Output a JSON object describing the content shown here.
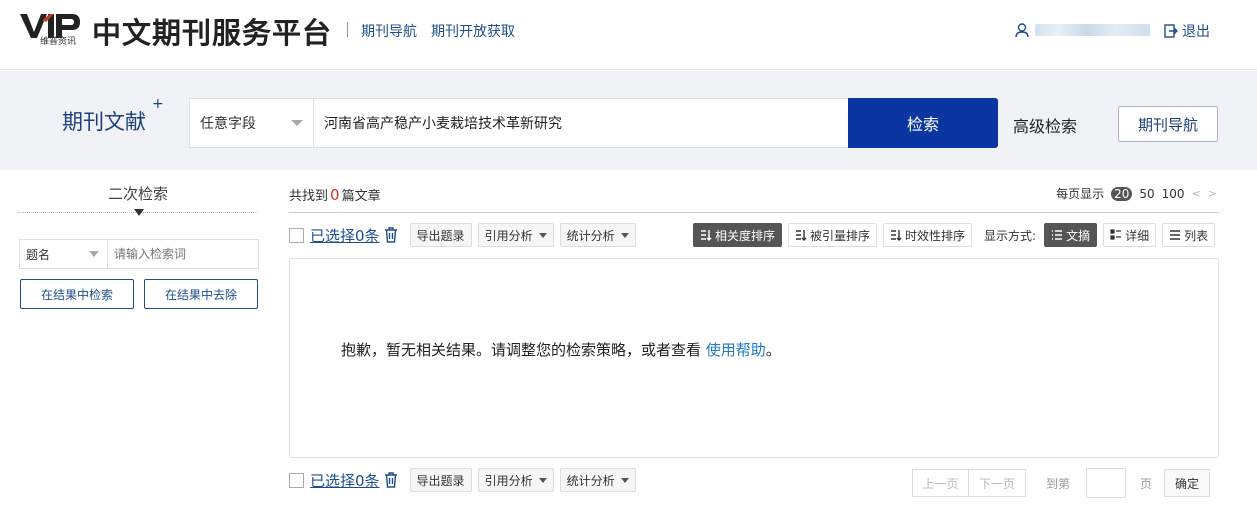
{
  "header": {
    "logo_text": "VIP",
    "logo_sub": "维普资讯",
    "brand": "中文期刊服务平台",
    "nav": [
      "期刊导航",
      "期刊开放获取"
    ],
    "logout": "退出"
  },
  "search": {
    "title": "期刊文献",
    "title_mark": "+",
    "field": "任意字段",
    "query": "河南省高产稳产小麦栽培技术革新研究",
    "button": "检索",
    "advanced": "高级检索",
    "journal_nav": "期刊导航"
  },
  "sidebar": {
    "title": "二次检索",
    "field": "题名",
    "placeholder": "请输入检索词",
    "search_in_results": "在结果中检索",
    "exclude_from_results": "在结果中去除"
  },
  "results": {
    "found_prefix": "共找到",
    "count": "0",
    "found_suffix": "篇文章",
    "per_page_label": "每页显示",
    "per_page_options": [
      "20",
      "50",
      "100"
    ],
    "per_page_selected": "20",
    "prev_arrow": "<",
    "next_arrow": ">",
    "empty_message": "抱歉，暂无相关结果。请调整您的检索策略，或者查看",
    "help_link": "使用帮助",
    "empty_message_end": "。"
  },
  "toolbar": {
    "selected": "已选择0条",
    "export": "导出题录",
    "citation": "引用分析",
    "statistics": "统计分析"
  },
  "sort": {
    "relevance": "相关度排序",
    "cited": "被引量排序",
    "timeliness": "时效性排序",
    "display_label": "显示方式:",
    "abstract": "文摘",
    "detail": "详细",
    "list": "列表"
  },
  "pager": {
    "prev": "上一页",
    "next": "下一页",
    "goto_prefix": "到第",
    "goto_suffix": "页",
    "confirm": "确定"
  },
  "colors": {
    "brand_blue": "#0b35a0",
    "link_blue": "#1f4e8c",
    "count_red": "#d93025",
    "active_gray": "#555555"
  }
}
